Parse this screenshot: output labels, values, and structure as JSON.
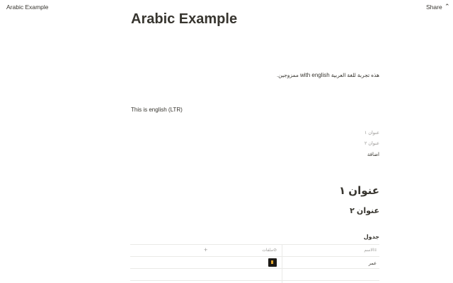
{
  "topbar": {
    "breadcrumb": "Arabic Example",
    "share_label": "Share",
    "more_label": "╰"
  },
  "page": {
    "title": "Arabic Example",
    "mixed_line_ar_1": "هذه تجربة للغة العربية",
    "mixed_line_en": "with english",
    "mixed_line_ar_2": "ممزوجين.",
    "ltr_line": "This is english (LTR)"
  },
  "toc": {
    "items": [
      "عنوان ١",
      "عنوان ٢"
    ],
    "add_label": "اضافة"
  },
  "headings": {
    "h1": "عنوان ١",
    "h2": "عنوان ٢"
  },
  "database": {
    "title": "جدول",
    "columns": [
      {
        "label": "الاسم",
        "icon": "text-property-icon"
      },
      {
        "label": "ملفات",
        "icon": "attachment-icon"
      }
    ],
    "add_column_label": "+",
    "rows": [
      {
        "name": "عمر",
        "file_icon": "file-thumbnail-icon"
      }
    ]
  }
}
